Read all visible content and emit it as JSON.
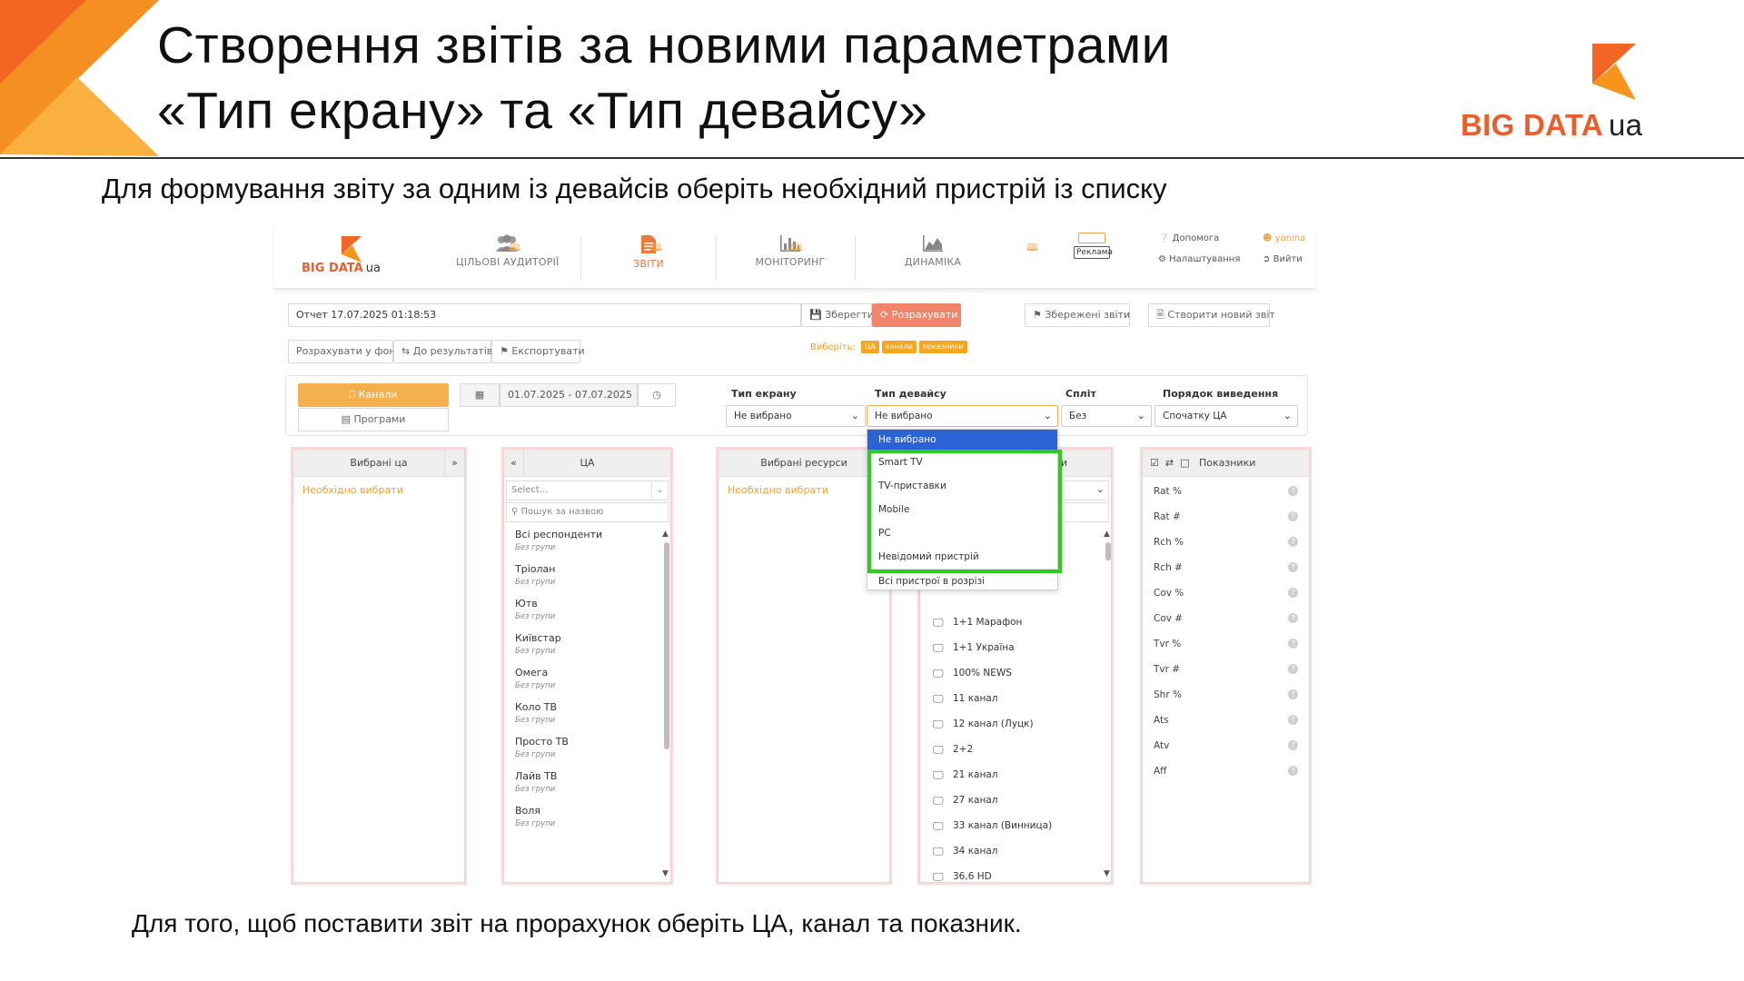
{
  "slide": {
    "title_line1": "Створення звітів за новими параметрами",
    "title_line2": "«Тип екрану» та «Тип девайсу»",
    "brand_main": "BIG DATA",
    "brand_suffix": "ua",
    "subtitle": "Для формування звіту за одним із девайсів оберіть необхідний пристрій із списку",
    "footer": "Для того, щоб поставити звіт на прорахунок оберіть ЦА, канал та показник.",
    "accent_colors": [
      "#f26522",
      "#f7941d",
      "#fbb040"
    ],
    "highlight_color": "#2ecc1e"
  },
  "app": {
    "logo_main": "BIG DATA",
    "logo_suffix": "ua",
    "nav": [
      {
        "label": "Цільові аудиторії",
        "icon": "users-icon"
      },
      {
        "label": "Звіти",
        "icon": "report-icon",
        "active": true
      },
      {
        "label": "Моніторинг",
        "icon": "bar-chart-icon"
      },
      {
        "label": "Динаміка",
        "icon": "area-chart-icon"
      }
    ],
    "reklama": "Реклама",
    "help": "Допомога",
    "settings": "Налаштування",
    "user": "yanina",
    "logout": "Вийти",
    "report_name": "Отчет 17.07.2025 01:18:53",
    "save": "Зберегти",
    "calculate": "Розрахувати",
    "saved_reports": "Збережені звіти",
    "new_report": "Створити новий звіт",
    "calc_background": "Розрахувати у фоні",
    "to_results": "До результатів",
    "export": "Експортувати",
    "choose_label": "Виберіть:",
    "choose_chips": [
      "ЦА",
      "канали",
      "показники"
    ],
    "channels_tab": "Канали",
    "programs_tab": "Програми",
    "date_range": "01.07.2025 - 07.07.2025",
    "screen_type_label": "Тип екрану",
    "screen_type_value": "Не вибрано",
    "device_type_label": "Тип девайсу",
    "device_type_value": "Не вибрано",
    "split_label": "Спліт",
    "split_value": "Без",
    "order_label": "Порядок виведення",
    "order_value": "Спочатку ЦА",
    "device_options": [
      "Не вибрано",
      "Smart TV",
      "TV-приставки",
      "Mobile",
      "PC",
      "Невідомий пристрій",
      "Всі пристрої в розрізі"
    ],
    "selected_ta_header": "Вибрані ца",
    "must_choose": "Необхідно вибрати",
    "ta_header": "ЦА",
    "ta_select_placeholder": "Select...",
    "ta_search_placeholder": "Пошук за назвою",
    "ta_group_note": "Без групи",
    "ta_items": [
      "Всі респонденти",
      "Тріолан",
      "Ютв",
      "Київстар",
      "Омега",
      "Коло ТВ",
      "Просто ТВ",
      "Лайв ТВ",
      "Воля"
    ],
    "selected_res_header": "Вибрані ресурси",
    "groups_header": "| Групи",
    "channels": [
      "1+1 Марафон",
      "1+1 Україна",
      "100% NEWS",
      "11 канал",
      "12 канал (Луцк)",
      "2+2",
      "21 канал",
      "27 канал",
      "33 канал (Винница)",
      "34 канал",
      "36,6 HD"
    ],
    "indicators_header": "Показники",
    "indicators": [
      "Rat %",
      "Rat #",
      "Rch %",
      "Rch #",
      "Cov %",
      "Cov #",
      "Tvr %",
      "Tvr #",
      "Shr %",
      "Ats",
      "Atv",
      "Aff"
    ]
  }
}
